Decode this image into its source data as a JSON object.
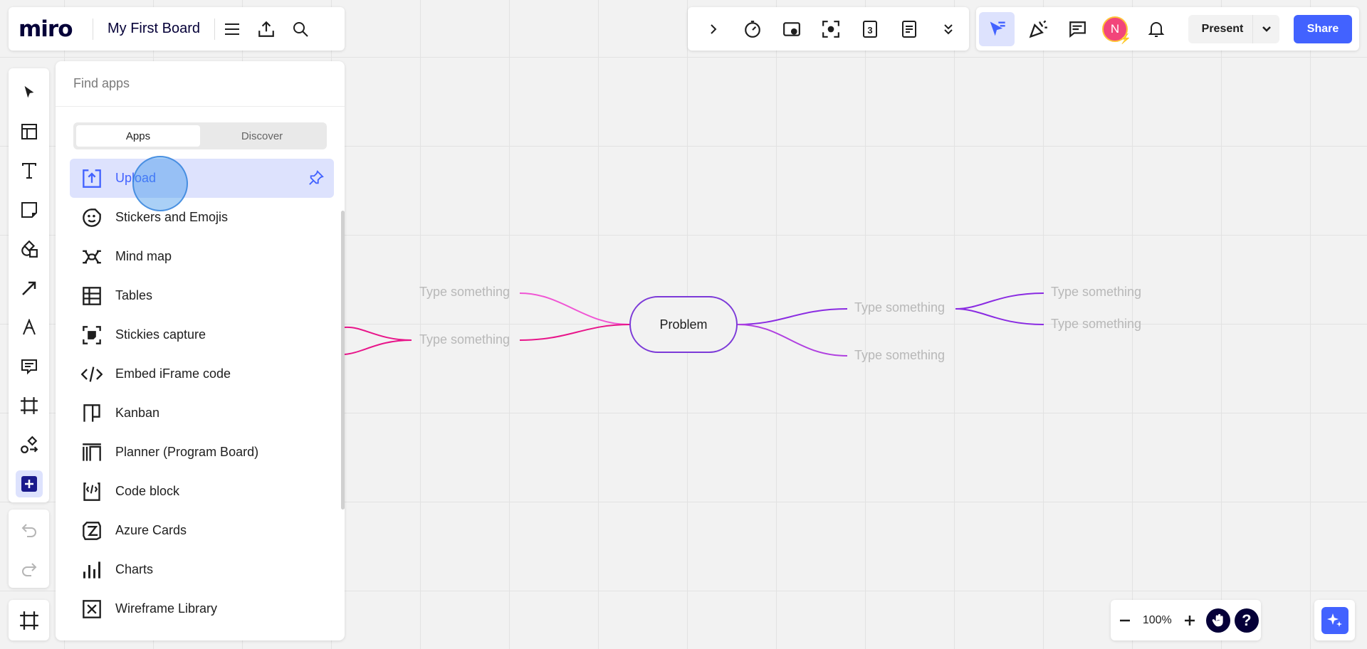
{
  "header": {
    "logo": "miro",
    "board_title": "My First Board"
  },
  "top_toolbar": {
    "items": [
      "expand-icon",
      "timer-icon",
      "video-icon",
      "focus-icon",
      "voting-icon",
      "notes-icon",
      "more-icon"
    ]
  },
  "top_right": {
    "avatar_initial": "N",
    "present_label": "Present",
    "share_label": "Share"
  },
  "apps_panel": {
    "search_placeholder": "Find apps",
    "tabs": [
      "Apps",
      "Discover"
    ],
    "active_tab": "Apps",
    "items": [
      {
        "label": "Upload",
        "icon": "upload-icon",
        "selected": true
      },
      {
        "label": "Stickers and Emojis",
        "icon": "sticker-icon"
      },
      {
        "label": "Mind map",
        "icon": "mindmap-icon"
      },
      {
        "label": "Tables",
        "icon": "table-icon"
      },
      {
        "label": "Stickies capture",
        "icon": "stickies-capture-icon"
      },
      {
        "label": "Embed iFrame code",
        "icon": "code-icon"
      },
      {
        "label": "Kanban",
        "icon": "kanban-icon"
      },
      {
        "label": "Planner (Program Board)",
        "icon": "planner-icon"
      },
      {
        "label": "Code block",
        "icon": "code-block-icon"
      },
      {
        "label": "Azure Cards",
        "icon": "azure-icon"
      },
      {
        "label": "Charts",
        "icon": "charts-icon"
      },
      {
        "label": "Wireframe Library",
        "icon": "wireframe-icon"
      }
    ]
  },
  "mindmap": {
    "center": "Problem",
    "left_nodes": [
      "Type something",
      "Type something"
    ],
    "right_nodes": [
      "Type something",
      "Type something"
    ],
    "right_children": [
      "Type something",
      "Type something"
    ]
  },
  "zoom": {
    "level": "100%"
  },
  "colors": {
    "accent": "#4262ff",
    "selected_bg": "#dde2fd",
    "mindmap_purple": "#7c3ad8",
    "mindmap_pink": "#e8158a"
  }
}
